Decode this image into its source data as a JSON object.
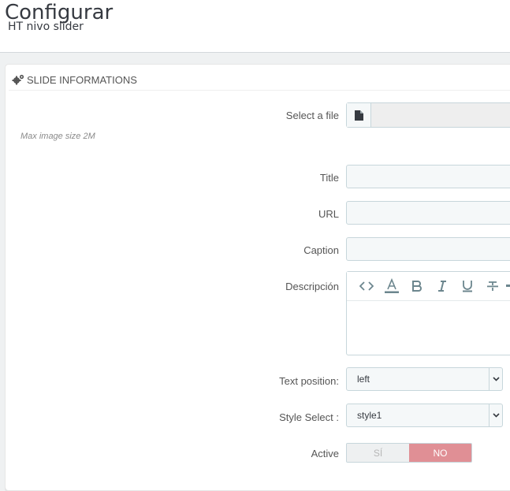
{
  "header": {
    "title": "Configurar",
    "subtitle": "HT nivo slider"
  },
  "panel": {
    "heading": "SLIDE INFORMATIONS",
    "heading_icon": "cogs-icon"
  },
  "form": {
    "file": {
      "label": "Select a file",
      "icon": "file-icon",
      "value": ""
    },
    "hint": "Max image size 2M",
    "title": {
      "label": "Title",
      "value": ""
    },
    "url": {
      "label": "URL",
      "value": ""
    },
    "caption": {
      "label": "Caption",
      "value": ""
    },
    "description": {
      "label": "Descripción",
      "toolbar": [
        "code-icon",
        "text-color-icon",
        "bold-icon",
        "italic-icon",
        "underline-icon",
        "strikethrough-icon"
      ]
    },
    "text_position": {
      "label": "Text position:",
      "value": "left"
    },
    "style_select": {
      "label": "Style Select :",
      "value": "style1"
    },
    "active": {
      "label": "Active",
      "yes": "SÍ",
      "no": "NO",
      "selected": "NO"
    }
  },
  "colors": {
    "switch_no": "#e08f95",
    "input_bg": "#f5f8f9",
    "input_border": "#c7d6db"
  }
}
